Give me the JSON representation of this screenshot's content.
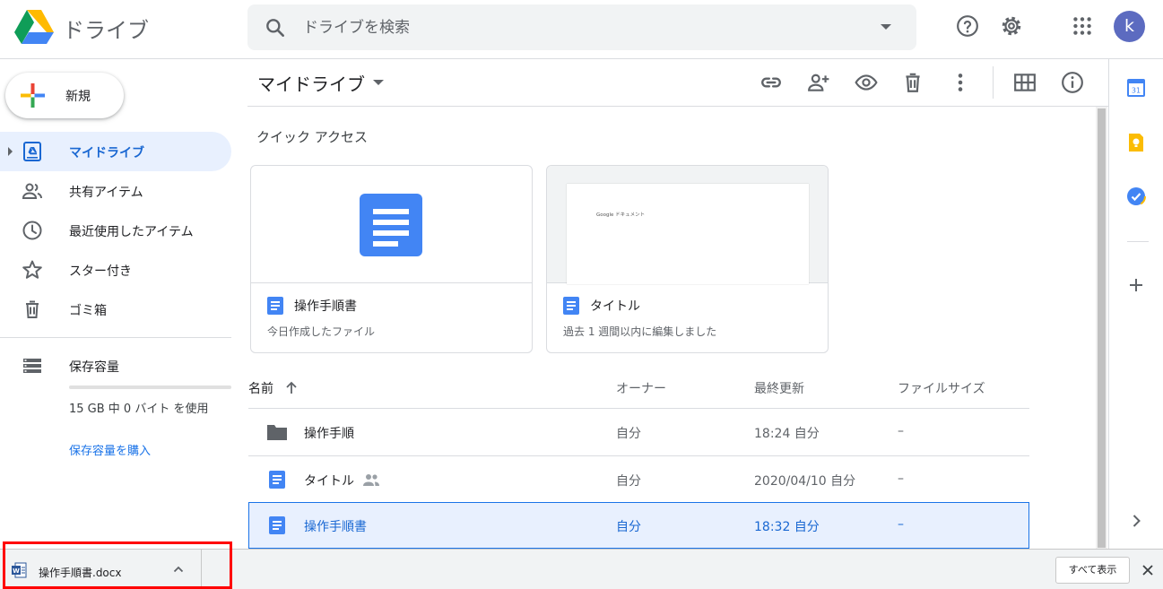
{
  "header": {
    "app_name": "ドライブ",
    "search_placeholder": "ドライブを検索",
    "avatar_letter": "k",
    "icons": [
      "drive-logo",
      "search-icon",
      "search-options-caret",
      "help-icon",
      "gear-icon",
      "apps-grid-icon"
    ]
  },
  "sidebar": {
    "new_label": "新規",
    "items": [
      {
        "label": "マイドライブ",
        "icon": "my-drive-icon",
        "active": true
      },
      {
        "label": "共有アイテム",
        "icon": "shared-people-icon",
        "active": false
      },
      {
        "label": "最近使用したアイテム",
        "icon": "clock-icon",
        "active": false
      },
      {
        "label": "スター付き",
        "icon": "star-icon",
        "active": false
      },
      {
        "label": "ゴミ箱",
        "icon": "trash-icon",
        "active": false
      }
    ],
    "storage": {
      "label": "保存容量",
      "usage": "15 GB 中 0 バイト を使用",
      "buy_link": "保存容量を購入"
    }
  },
  "toolbar": {
    "title": "マイドライブ",
    "icons": [
      "link-icon",
      "add-person-icon",
      "preview-eye-icon",
      "trash-icon",
      "more-vert-icon",
      "grid-view-icon",
      "info-icon"
    ]
  },
  "quick_access": {
    "title": "クイック アクセス",
    "cards": [
      {
        "name": "操作手順書",
        "subtitle": "今日作成したファイル"
      },
      {
        "name": "タイトル",
        "subtitle": "過去 1 週間以内に編集しました",
        "thumb_text": "Google ドキュメント"
      }
    ]
  },
  "file_list": {
    "columns": {
      "name": "名前",
      "owner": "オーナー",
      "modified": "最終更新",
      "size": "ファイルサイズ"
    },
    "rows": [
      {
        "name": "操作手順",
        "type": "folder",
        "owner": "自分",
        "modified": "18:24 自分",
        "size": "–"
      },
      {
        "name": "タイトル",
        "type": "doc",
        "shared": true,
        "owner": "自分",
        "modified": "2020/04/10 自分",
        "size": "–"
      },
      {
        "name": "操作手順書",
        "type": "doc",
        "selected": true,
        "owner": "自分",
        "modified": "18:32 自分",
        "size": "–"
      }
    ]
  },
  "side_panel": {
    "calendar_day": "31",
    "icons": [
      "calendar-icon",
      "keep-icon",
      "tasks-icon",
      "add-icon",
      "chevron-right-icon"
    ]
  },
  "download_shelf": {
    "file_name": "操作手順書.docx",
    "show_all": "すべて表示"
  },
  "colors": {
    "accent": "#1a73e8",
    "active_bg": "#e8f0fe",
    "doc_blue": "#4285f4",
    "highlight": "#ff0000"
  }
}
